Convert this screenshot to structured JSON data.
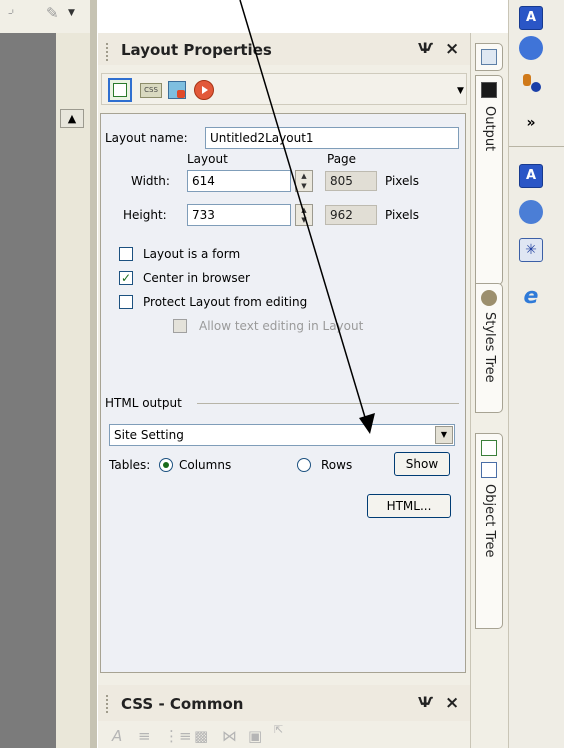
{
  "panel": {
    "title": "Layout Properties",
    "pin_glyph": "Ѱ",
    "close_glyph": "×",
    "toolbar": [
      "layout-icon",
      "css-icon",
      "image-icon",
      "play-icon"
    ],
    "toolbar_css_text": "CSS",
    "layout_name_label": "Layout name:",
    "layout_name_value": "Untitled2Layout1",
    "col_layout": "Layout",
    "col_page": "Page",
    "width_label": "Width:",
    "width_value": "614",
    "width_page": "805",
    "height_label": "Height:",
    "height_value": "733",
    "height_page": "962",
    "pixels": "Pixels",
    "chk_form": "Layout is a form",
    "chk_center": "Center in browser",
    "chk_protect": "Protect Layout from editing",
    "chk_allow": "Allow text editing in Layout",
    "html_output_label": "HTML output",
    "site_setting": "Site Setting",
    "tables_label": "Tables:",
    "columns_label": "Columns",
    "rows_label": "Rows",
    "show_button": "Show",
    "html_button": "HTML...",
    "checkbox_states": {
      "form": false,
      "center": true,
      "protect": false,
      "allow": false
    },
    "tables_selected": "Columns"
  },
  "css_panel": {
    "title": "CSS - Common"
  },
  "right_tabs": [
    "Output",
    "Styles Tree",
    "Object Tree"
  ],
  "colors": {
    "accent_blue": "#2a56c6",
    "panel_bg": "#f1efe6",
    "content_bg": "#eef0f5",
    "left_gray": "#7b7b7b"
  },
  "right_icons": [
    "app-a-icon",
    "refresh-icon",
    "phone-icon",
    "more-icon",
    "app-a-icon",
    "globe-icon",
    "star-icon",
    "ie-icon"
  ],
  "more_glyph": "»"
}
